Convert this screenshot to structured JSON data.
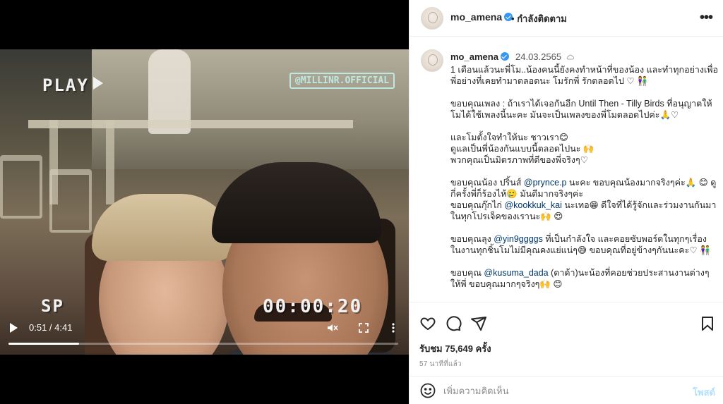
{
  "video": {
    "vhs_play": "PLAY",
    "vhs_sp": "SP",
    "vhs_timecode": "00:00:20",
    "watermark": "@MILLINR.OFFICIAL",
    "current_time": "0:51",
    "duration": "4:41",
    "time_display": "0:51 / 4:41",
    "progress": 0.181
  },
  "header": {
    "username": "mo_amena",
    "separator": "•",
    "follow_state": "กำลังติดตาม",
    "more_label": "•••"
  },
  "caption": {
    "username": "mo_amena",
    "date": "24.03.2565",
    "paragraphs": [
      "1 เดือนแล้วนะพี่โม..น้องคนนี้ยังคงทำหน้าที่ของน้อง และทำทุกอย่างเพื่อพี่อย่างที่เคยทำมาตลอดนะ โมรักพี่ รักตลอดไป ♡ 👫",
      "ขอบคุณเพลง : ถ้าเราได้เจอกันอีก Until Then - Tilly Birds ที่อนุญาตให้โมได้ใช้เพลงนี้นะคะ มันจะเป็นเพลงของพี่โมตลอดไปค่ะ🙏♡",
      "และโมตั้งใจทำให้นะ ชาวเรา😊\nดูแลเป็นพี่น้องกันแบบนี้ตลอดไปนะ 🙌\nพวกคุณเป็นมิตรภาพที่ดีของพี่จริงๆ♡",
      "ขอบคุณน้อง ปริ้นส์ @prynce.p นะคะ ขอบคุณน้องมากจริงๆค่ะ🙏 😊 ดูกี่ครั้งพี่ก็ร้องไห้🥲 มันดีมากจริงๆค่ะ\nขอบคุณกุ๊กไก่ @kookkuk_kai นะเทอ😁 ดีใจที่ได้รู้จักและร่วมงานกันมาในทุกโปรเจ็คของเรานะ🙌 😍",
      "ขอบคุณลุง @yin9ggggs ที่เป็นกำลังใจ และคอยซับพอร์ตในทุกๆเรื่อง ในงานทุกชิ้นโมไม่มีคุณคงแย่แน่ๆ😅 ขอบคุณที่อยู่ข้างๆกันนะคะ♡ 👫",
      "ขอบคุณ @kusuma_dada (ดาด้า)นะน้องที่คอยช่วยประสานงานต่างๆให้พี่ ขอบคุณมากๆจริงๆ🙌 😊"
    ]
  },
  "actions": {
    "views_label": "รับชม",
    "views_count": "75,649",
    "views_unit": "ครั้ง",
    "views_text": "รับชม 75,649 ครั้ง",
    "time_ago": "57 นาทีที่แล้ว"
  },
  "comment": {
    "placeholder": "เพิ่มความคิดเห็น",
    "post_label": "โพสต์"
  },
  "colors": {
    "link": "#00376b",
    "verified": "#3897f0",
    "post_disabled": "#b2dffc"
  }
}
